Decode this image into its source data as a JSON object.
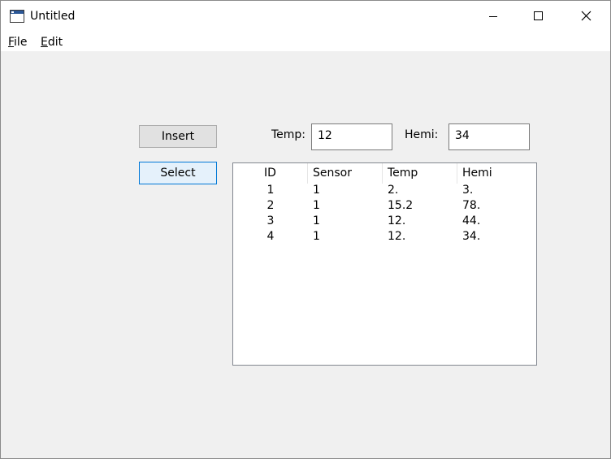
{
  "window": {
    "title": "Untitled"
  },
  "menu": {
    "items": [
      {
        "accel": "F",
        "rest": "ile"
      },
      {
        "accel": "E",
        "rest": "dit"
      }
    ]
  },
  "buttons": {
    "insert": "Insert",
    "select": "Select"
  },
  "fields": {
    "temp_label": "Temp:",
    "temp_value": "12",
    "hemi_label": "Hemi:",
    "hemi_value": "34"
  },
  "table": {
    "columns": [
      "ID",
      "Sensor",
      "Temp",
      "Hemi"
    ],
    "rows": [
      [
        "1",
        "1",
        "2.",
        "3."
      ],
      [
        "2",
        "1",
        "15.2",
        "78."
      ],
      [
        "3",
        "1",
        "12.",
        "44."
      ],
      [
        "4",
        "1",
        "12.",
        "34."
      ]
    ]
  },
  "colors": {
    "accent_focus": "#0078d7",
    "button_face": "#e1e1e1",
    "client_bg": "#f0f0f0"
  }
}
